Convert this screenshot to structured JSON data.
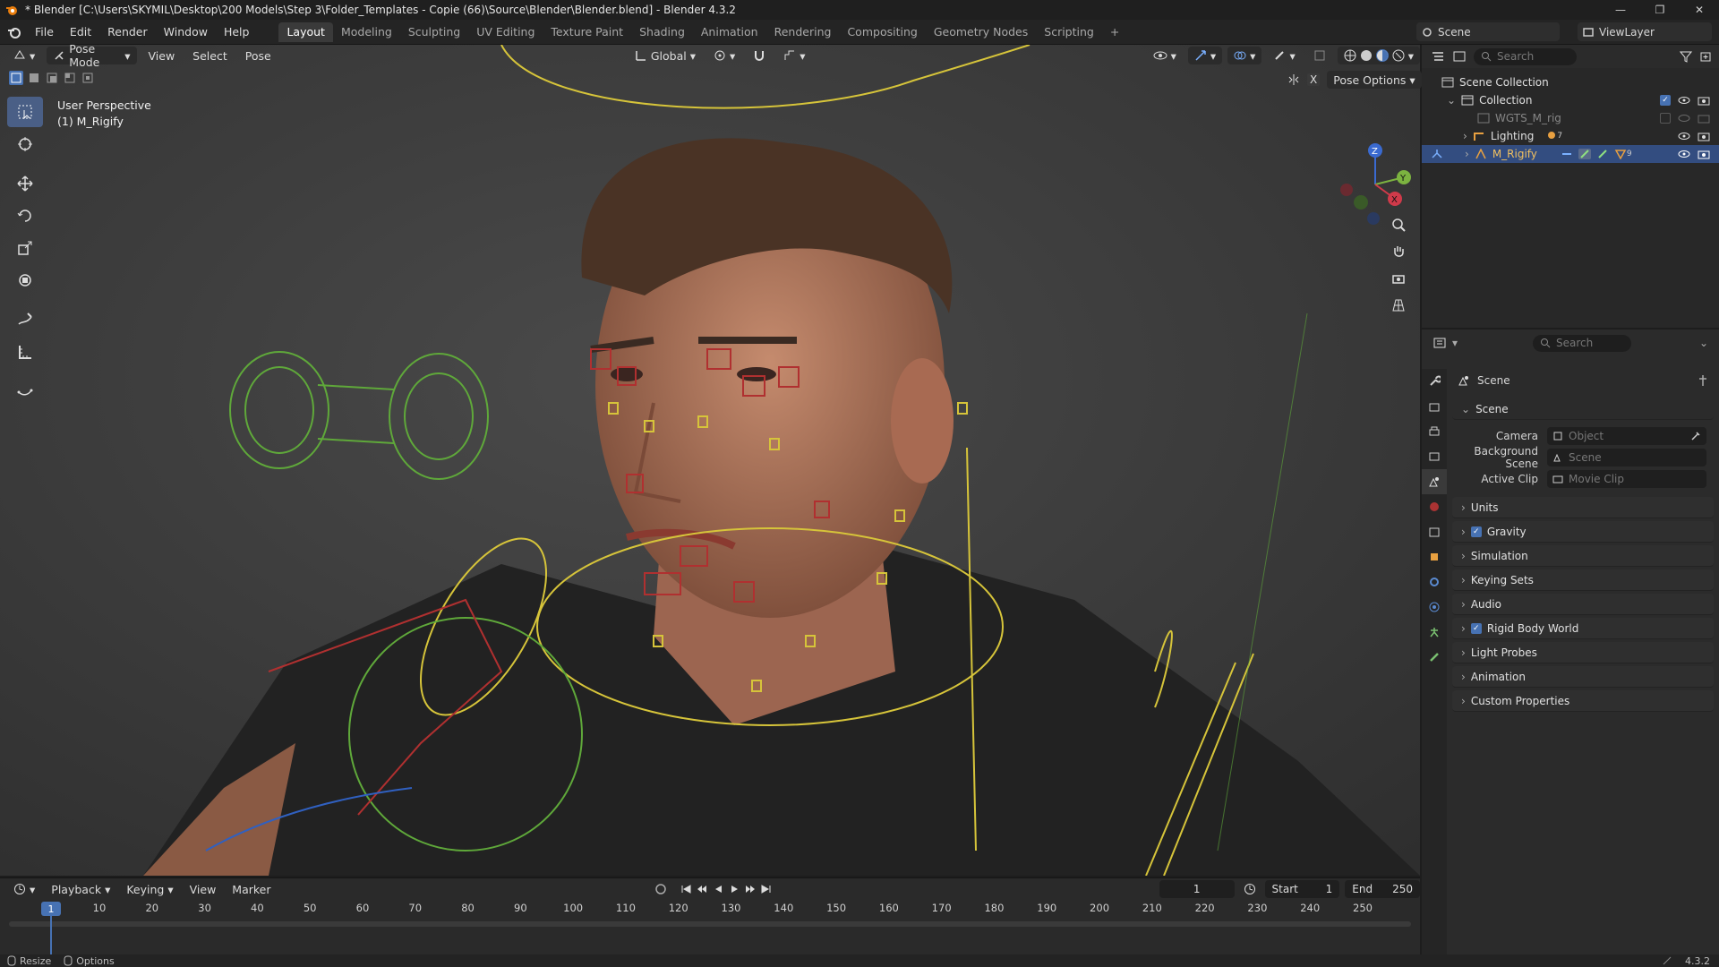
{
  "window": {
    "title": "* Blender [C:\\Users\\SKYMIL\\Desktop\\200 Models\\Step 3\\Folder_Templates - Copie (66)\\Source\\Blender\\Blender.blend] - Blender 4.3.2",
    "controls": [
      "—",
      "❐",
      "✕"
    ]
  },
  "menubar": {
    "menus": [
      "File",
      "Edit",
      "Render",
      "Window",
      "Help"
    ],
    "workspaces": [
      "Layout",
      "Modeling",
      "Sculpting",
      "UV Editing",
      "Texture Paint",
      "Shading",
      "Animation",
      "Rendering",
      "Compositing",
      "Geometry Nodes",
      "Scripting",
      "+"
    ],
    "active_workspace": "Layout",
    "scene": "Scene",
    "view_layer": "ViewLayer"
  },
  "viewport": {
    "mode": "Pose Mode",
    "menus": [
      "View",
      "Select",
      "Pose"
    ],
    "transform_orientation": "Global",
    "pose_options": "Pose Options",
    "overlay_text_line1": "User Perspective",
    "overlay_text_line2": "(1) M_Rigify",
    "gizmo_axes": [
      "Z",
      "Y",
      "X"
    ]
  },
  "outliner": {
    "search_placeholder": "Search",
    "rows": [
      {
        "label": "Scene Collection"
      },
      {
        "label": "Collection"
      },
      {
        "label": "WGTS_M_rig"
      },
      {
        "label": "Lighting"
      },
      {
        "label": "M_Rigify"
      }
    ],
    "lighting_count": "7",
    "rig_count": "9"
  },
  "properties": {
    "search_placeholder": "Search",
    "context": "Scene",
    "section": "Scene",
    "fields": [
      {
        "label": "Camera",
        "placeholder": "Object"
      },
      {
        "label": "Background Scene",
        "placeholder": "Scene"
      },
      {
        "label": "Active Clip",
        "placeholder": "Movie Clip"
      }
    ],
    "panels": [
      {
        "label": "Units",
        "checkbox": false
      },
      {
        "label": "Gravity",
        "checkbox": true
      },
      {
        "label": "Simulation",
        "checkbox": false
      },
      {
        "label": "Keying Sets",
        "checkbox": false
      },
      {
        "label": "Audio",
        "checkbox": false
      },
      {
        "label": "Rigid Body World",
        "checkbox": true
      },
      {
        "label": "Light Probes",
        "checkbox": false
      },
      {
        "label": "Animation",
        "checkbox": false
      },
      {
        "label": "Custom Properties",
        "checkbox": false
      }
    ]
  },
  "timeline": {
    "menus": [
      "Playback",
      "Keying",
      "View",
      "Marker"
    ],
    "current_frame": "1",
    "start_label": "Start",
    "start": "1",
    "end_label": "End",
    "end": "250",
    "ticks": [
      "10",
      "20",
      "30",
      "40",
      "50",
      "60",
      "70",
      "80",
      "90",
      "100",
      "110",
      "120",
      "130",
      "140",
      "150",
      "160",
      "170",
      "180",
      "190",
      "200",
      "210",
      "220",
      "230",
      "240",
      "250"
    ]
  },
  "statusbar": {
    "left1": "Resize",
    "left2": "Options",
    "version": "4.3.2"
  },
  "colors": {
    "accent": "#4772b3",
    "selection": "#334d80",
    "bone_yellow": "#d6c43a",
    "bone_green": "#5fa83a",
    "bone_red": "#b03030"
  }
}
